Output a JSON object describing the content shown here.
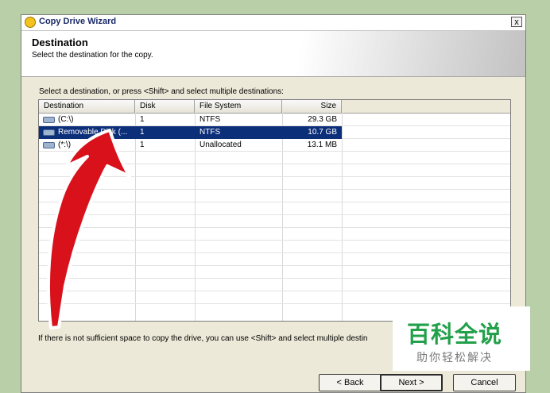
{
  "window": {
    "title": "Copy Drive Wizard",
    "close_label": "x"
  },
  "header": {
    "title": "Destination",
    "subtitle": "Select the destination for the copy."
  },
  "instruction": "Select a destination, or press <Shift> and select multiple destinations:",
  "table": {
    "columns": [
      "Destination",
      "Disk",
      "File System",
      "Size"
    ],
    "rows": [
      {
        "destination": "(C:\\)",
        "disk": "1",
        "fs": "NTFS",
        "size": "29.3 GB",
        "selected": false
      },
      {
        "destination": "Removable Disk (...",
        "disk": "1",
        "fs": "NTFS",
        "size": "10.7 GB",
        "selected": true
      },
      {
        "destination": "(*:\\)",
        "disk": "1",
        "fs": "Unallocated",
        "size": "13.1 MB",
        "selected": false
      }
    ]
  },
  "note": "If there is not sufficient space to copy the drive, you can use <Shift> and select multiple destin",
  "buttons": {
    "back": "< Back",
    "next": "Next >",
    "cancel": "Cancel"
  },
  "watermark": {
    "main": "百科全说",
    "sub": "助你轻松解决"
  },
  "colors": {
    "selection": "#0c2f7a",
    "arrow": "#d8111b",
    "watermark_green": "#23a04b"
  },
  "icons": {
    "app": "wizard-app-icon",
    "drive": "hard-drive-icon",
    "arrow": "red-arrow-annotation"
  }
}
